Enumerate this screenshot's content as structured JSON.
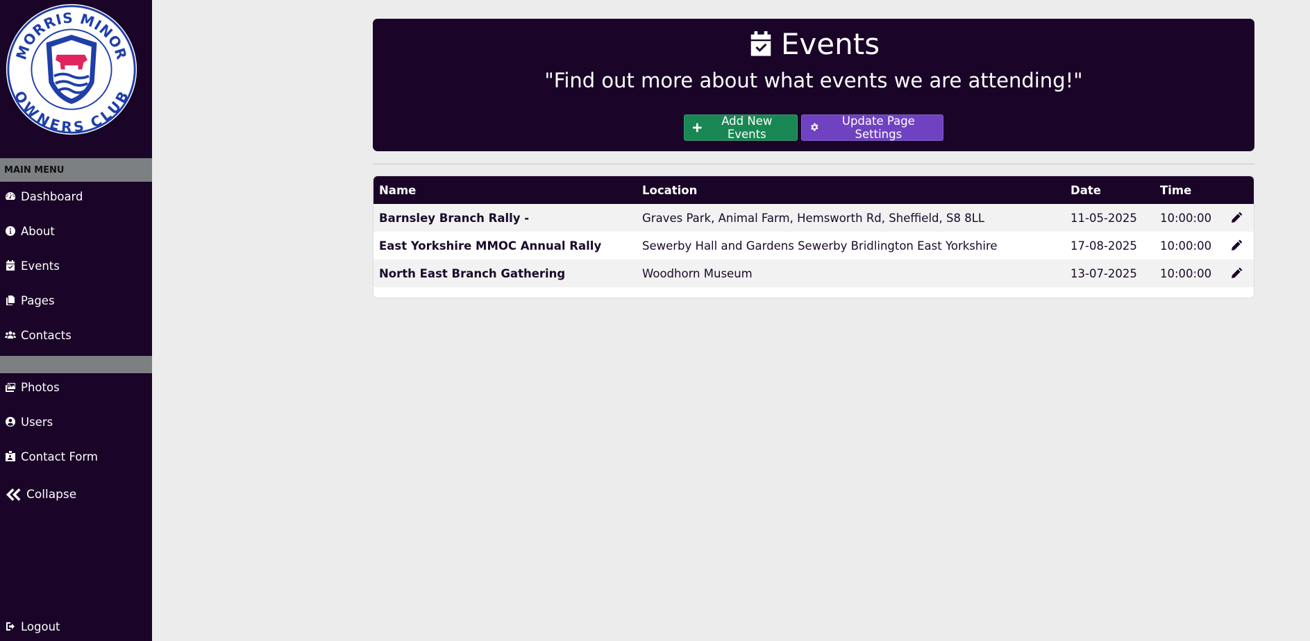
{
  "sidebar": {
    "logo": {
      "text_top": "MORRIS MINOR",
      "text_bottom": "OWNERS CLUB",
      "colors": {
        "ring": "#1f3fa8",
        "bull": "#e0245e"
      }
    },
    "menu_header": "MAIN MENU",
    "items": [
      {
        "label": "Dashboard",
        "icon": "gauge-icon"
      },
      {
        "label": "About",
        "icon": "info-circle-icon"
      },
      {
        "label": "Events",
        "icon": "calendar-check-icon"
      },
      {
        "label": "Pages",
        "icon": "copy-icon"
      },
      {
        "label": "Contacts",
        "icon": "users-icon"
      }
    ],
    "items2": [
      {
        "label": "Photos",
        "icon": "images-icon"
      },
      {
        "label": "Users",
        "icon": "user-circle-icon"
      },
      {
        "label": "Contact Form",
        "icon": "id-badge-icon"
      }
    ],
    "collapse_label": "Collapse",
    "logout_label": "Logout"
  },
  "banner": {
    "title": "Events",
    "subtitle": "\"Find out more about what events we are attending!\"",
    "add_button": "Add New Events",
    "settings_button": "Update Page Settings"
  },
  "table": {
    "headers": {
      "name": "Name",
      "location": "Location",
      "date": "Date",
      "time": "Time"
    },
    "rows": [
      {
        "name": "Barnsley Branch Rally -",
        "location": "Graves Park, Animal Farm, Hemsworth Rd, Sheffield, S8 8LL",
        "date": "11-05-2025",
        "time": "10:00:00"
      },
      {
        "name": "East Yorkshire MMOC Annual Rally",
        "location": "Sewerby Hall and Gardens Sewerby Bridlington East Yorkshire",
        "date": "17-08-2025",
        "time": "10:00:00"
      },
      {
        "name": "North East Branch Gathering",
        "location": "Woodhorn Museum",
        "date": "13-07-2025",
        "time": "10:00:00"
      }
    ]
  },
  "colors": {
    "primary": "#1a0428",
    "sidebar_header": "#7c8083",
    "green": "#198754",
    "purple": "#6f42c1",
    "background": "#ececec"
  }
}
